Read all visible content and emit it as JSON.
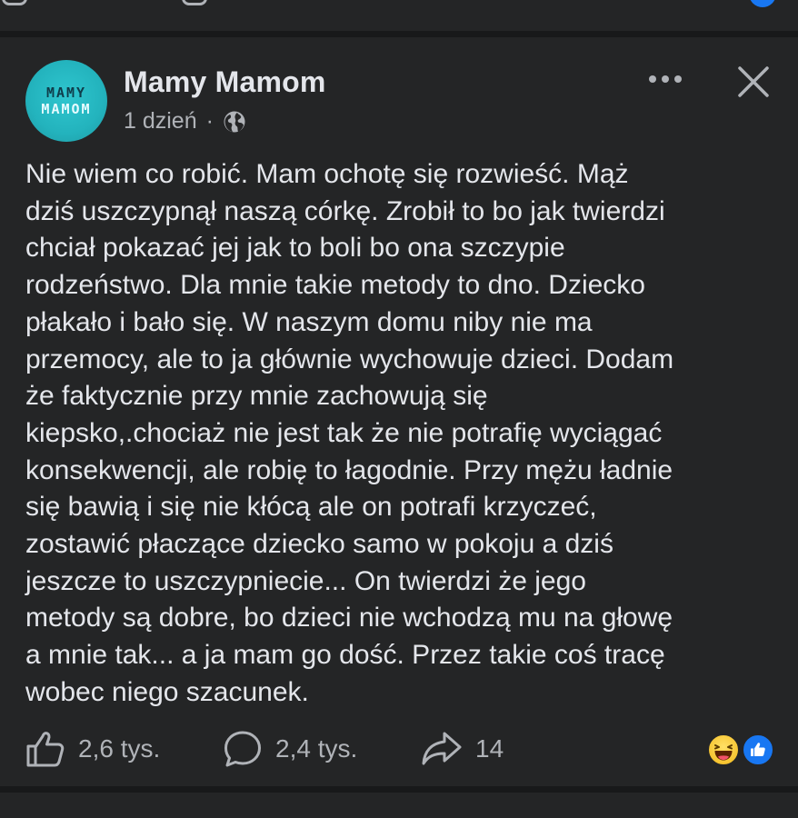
{
  "post": {
    "author": "Mamy Mamom",
    "avatar": {
      "line1": "MAMY",
      "line2": "MAMOM"
    },
    "time": "1 dzień",
    "separator": "·",
    "audience_icon": "globe-icon",
    "text": "Nie wiem co robić. Mam ochotę się rozwieść. Mąż\ndziś uszczypnął naszą córkę. Zrobił to bo jak twierdzi\nchciał pokazać jej jak to boli bo ona szczypie\nrodzeństwo. Dla mnie takie metody to dno. Dziecko\npłakało i bało się. W naszym domu niby nie ma\nprzemocy, ale to ja głównie wychowuje dzieci. Dodam\nże faktycznie przy mnie zachowują się\nkiepsko,.chociaż nie jest tak że nie potrafię wyciągać\nkonsekwencji, ale robię to łagodnie. Przy mężu ładnie\nsię bawią i się nie kłócą ale on potrafi krzyczeć,\nzostawić płaczące dziecko samo w pokoju a dziś\njeszcze to uszczypniecie... On twierdzi że jego\nmetody są dobre, bo dzieci nie wchodzą mu na głowę\na mnie tak... a ja mam go dość. Przez takie coś tracę\nwobec niego szacunek.",
    "actions": {
      "like_count": "2,6 tys.",
      "comment_count": "2,4 tys.",
      "share_count": "14"
    },
    "reactions": [
      "haha",
      "like"
    ]
  },
  "colors": {
    "background": "#242526",
    "divider": "#18191a",
    "text_primary": "#e4e6eb",
    "text_secondary": "#b0b3b8",
    "accent_blue": "#1877f2",
    "avatar_teal": "#23b3bd"
  }
}
